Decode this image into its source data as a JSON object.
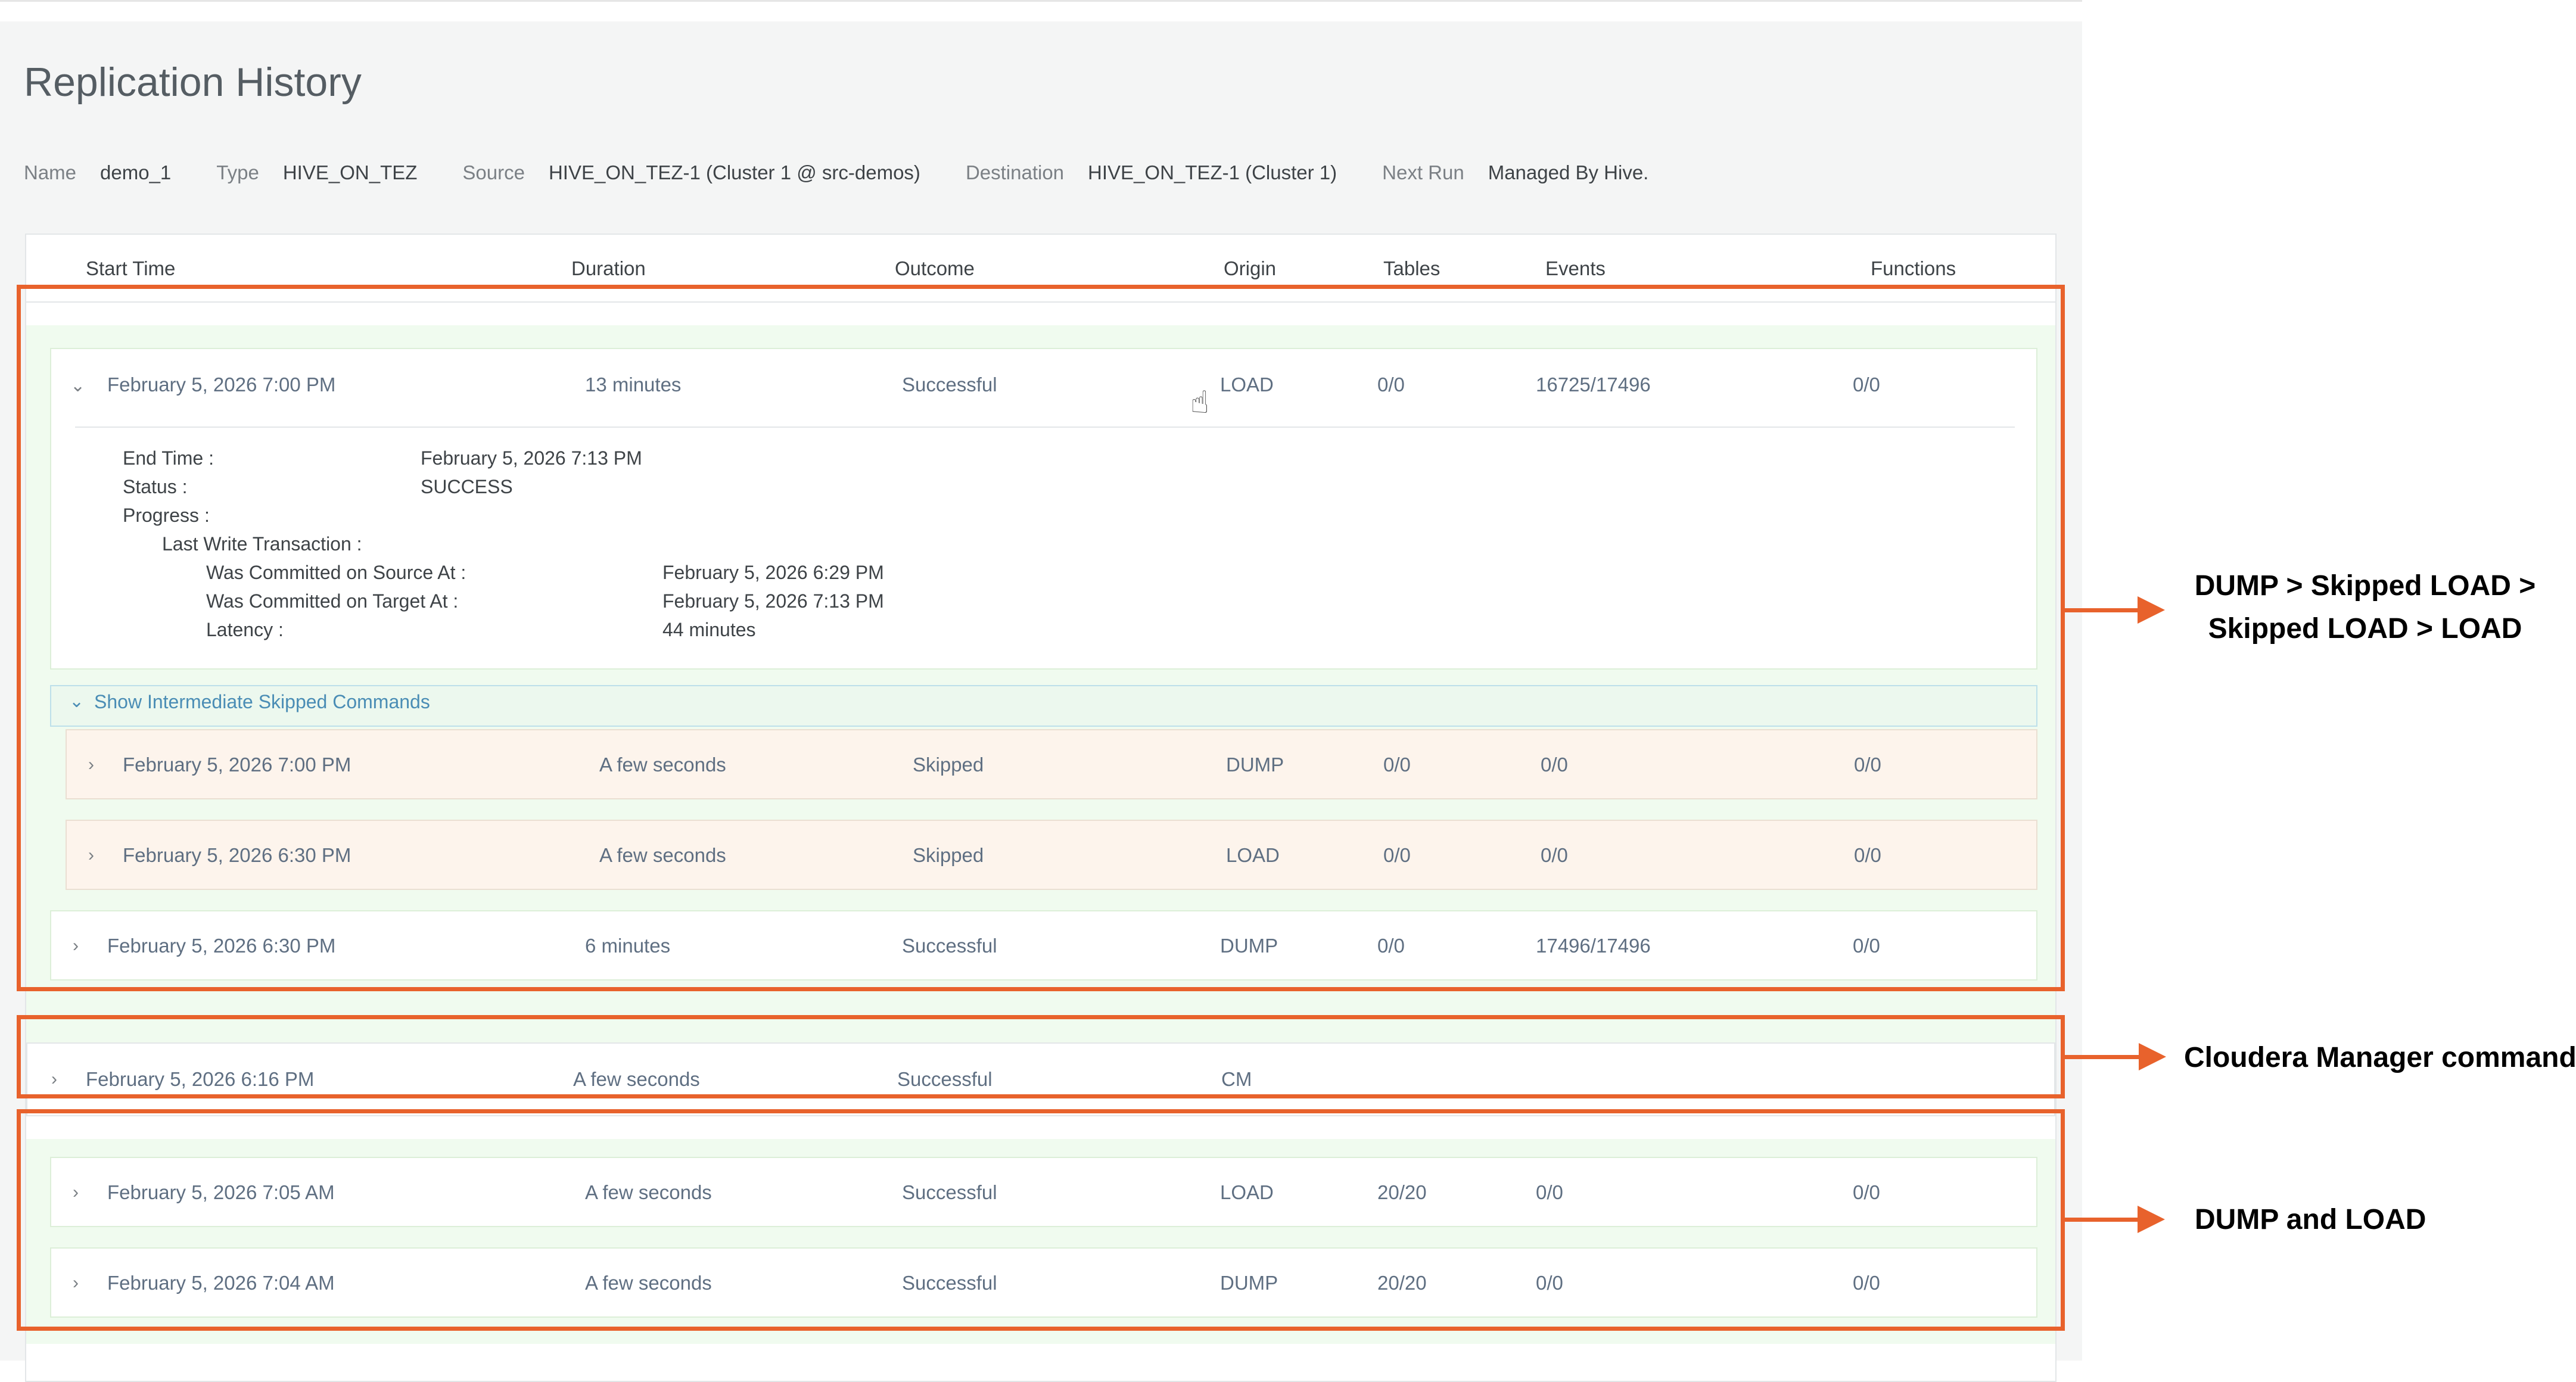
{
  "page": {
    "title": "Replication History"
  },
  "meta": {
    "name_label": "Name",
    "name_value": "demo_1",
    "type_label": "Type",
    "type_value": "HIVE_ON_TEZ",
    "source_label": "Source",
    "source_value": "HIVE_ON_TEZ-1 (Cluster 1 @ src-demos)",
    "destination_label": "Destination",
    "destination_value": "HIVE_ON_TEZ-1 (Cluster 1)",
    "next_run_label": "Next Run",
    "next_run_value": "Managed By Hive."
  },
  "columns": {
    "start_time": "Start Time",
    "duration": "Duration",
    "outcome": "Outcome",
    "origin": "Origin",
    "tables": "Tables",
    "events": "Events",
    "functions": "Functions"
  },
  "group1": {
    "main": {
      "start": "February 5, 2026 7:00 PM",
      "duration": "13 minutes",
      "outcome": "Successful",
      "origin": "LOAD",
      "tables": "0/0",
      "events": "16725/17496",
      "functions": "0/0"
    },
    "details": {
      "end_time_label": "End Time :",
      "end_time_value": "February 5, 2026 7:13 PM",
      "status_label": "Status :",
      "status_value": "SUCCESS",
      "progress_label": "Progress :",
      "lwt_label": "Last Write Transaction :",
      "source_label": "Was Committed on Source At :",
      "source_value": "February 5, 2026 6:29 PM",
      "target_label": "Was Committed on Target At :",
      "target_value": "February 5, 2026 7:13 PM",
      "latency_label": "Latency :",
      "latency_value": "44 minutes"
    },
    "skip_toggle_label": "Show Intermediate Skipped Commands",
    "skipped": [
      {
        "start": "February 5, 2026 7:00 PM",
        "duration": "A few seconds",
        "outcome": "Skipped",
        "origin": "DUMP",
        "tables": "0/0",
        "events": "0/0",
        "functions": "0/0"
      },
      {
        "start": "February 5, 2026 6:30 PM",
        "duration": "A few seconds",
        "outcome": "Skipped",
        "origin": "LOAD",
        "tables": "0/0",
        "events": "0/0",
        "functions": "0/0"
      }
    ],
    "last": {
      "start": "February 5, 2026 6:30 PM",
      "duration": "6 minutes",
      "outcome": "Successful",
      "origin": "DUMP",
      "tables": "0/0",
      "events": "17496/17496",
      "functions": "0/0"
    }
  },
  "group2": {
    "row": {
      "start": "February 5, 2026 6:16 PM",
      "duration": "A few seconds",
      "outcome": "Successful",
      "origin": "CM"
    }
  },
  "group3": {
    "rows": [
      {
        "start": "February 5, 2026 7:05 AM",
        "duration": "A few seconds",
        "outcome": "Successful",
        "origin": "LOAD",
        "tables": "20/20",
        "events": "0/0",
        "functions": "0/0"
      },
      {
        "start": "February 5, 2026 7:04 AM",
        "duration": "A few seconds",
        "outcome": "Successful",
        "origin": "DUMP",
        "tables": "20/20",
        "events": "0/0",
        "functions": "0/0"
      }
    ]
  },
  "annotations": {
    "group1_line1": "DUMP > Skipped LOAD >",
    "group1_line2": "Skipped LOAD > LOAD",
    "group2": "Cloudera Manager command",
    "group3": "DUMP and LOAD"
  },
  "colors": {
    "highlight": "#e8622c",
    "success_group_bg": "#f0fbef",
    "skipped_row_bg": "#fdf4ec",
    "link_blue": "#4a8db5"
  }
}
